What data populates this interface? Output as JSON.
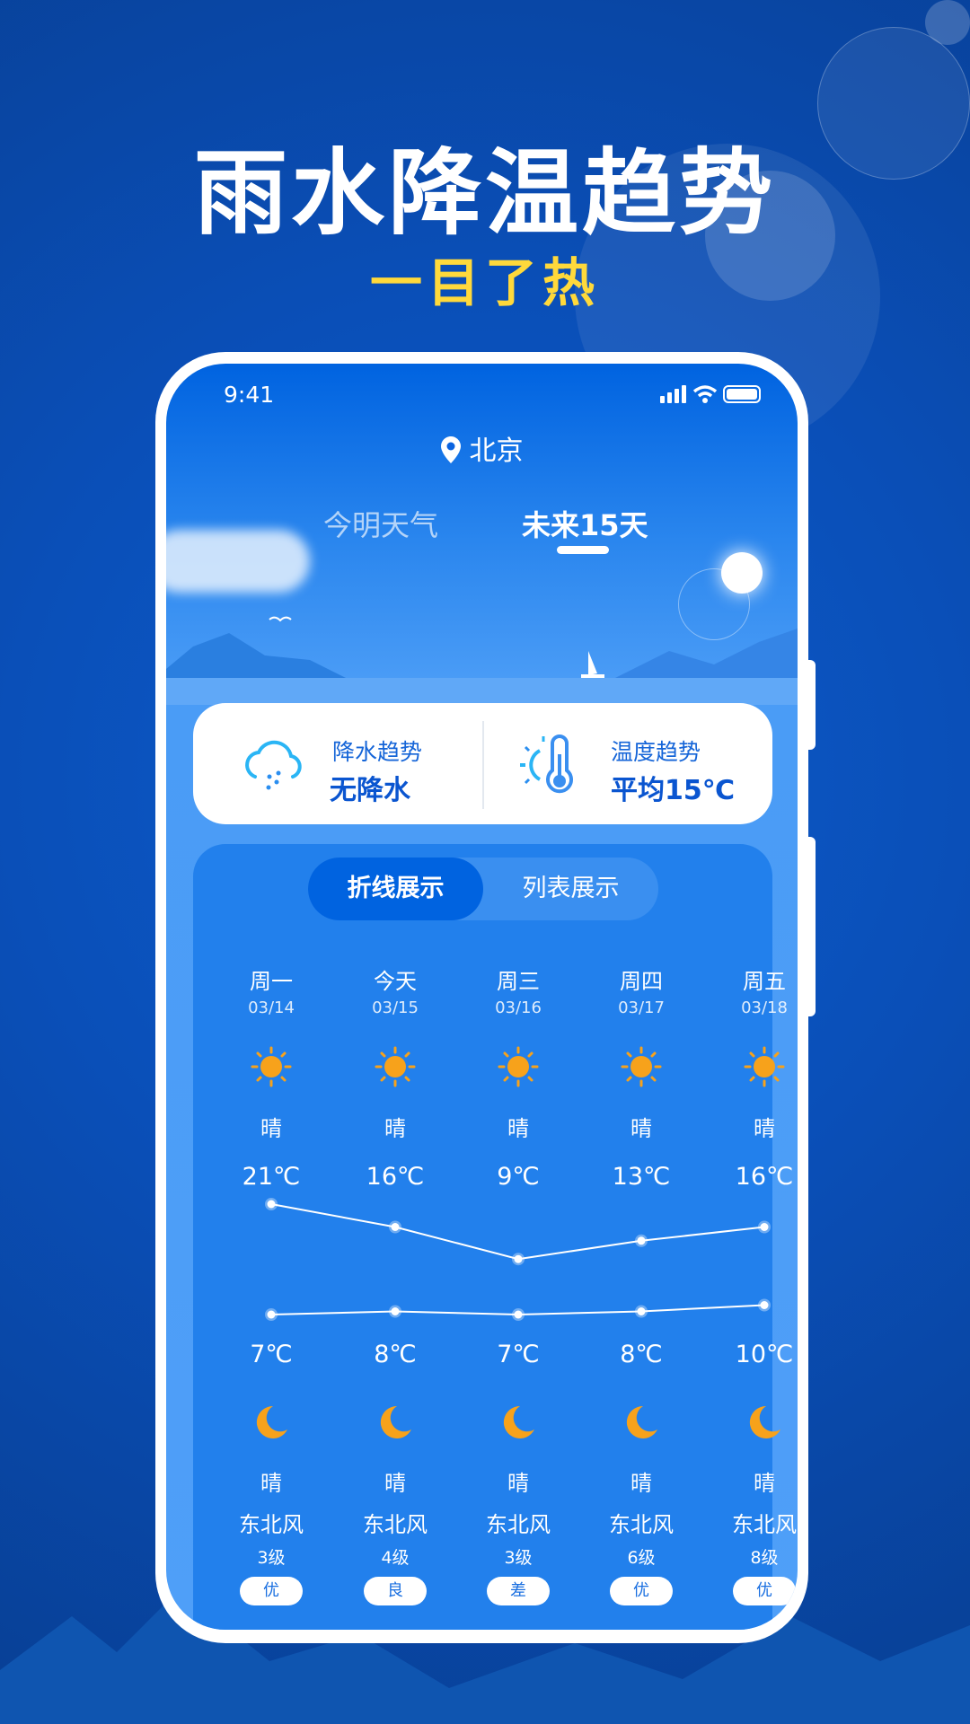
{
  "promo": {
    "title": "雨水降温趋势",
    "subtitle": "一目了热"
  },
  "status_bar": {
    "time": "9:41"
  },
  "location": {
    "city": "北京",
    "icon": "location-pin-icon"
  },
  "tabs": [
    {
      "label": "今明天气",
      "active": false
    },
    {
      "label": "未来15天",
      "active": true
    }
  ],
  "summary": {
    "precipitation": {
      "label": "降水趋势",
      "value": "无降水",
      "icon": "rain-cloud-icon"
    },
    "temperature": {
      "label": "温度趋势",
      "value": "平均15℃",
      "icon": "thermometer-sun-icon"
    }
  },
  "view_toggle": [
    {
      "label": "折线展示",
      "active": true
    },
    {
      "label": "列表展示",
      "active": false
    }
  ],
  "days": [
    {
      "day": "周一",
      "date": "03/14",
      "day_weather": "晴",
      "high": "21℃",
      "low": "7℃",
      "night_weather": "晴",
      "wind": "东北风",
      "level": "3级",
      "aqi": "优"
    },
    {
      "day": "今天",
      "date": "03/15",
      "day_weather": "晴",
      "high": "16℃",
      "low": "8℃",
      "night_weather": "晴",
      "wind": "东北风",
      "level": "4级",
      "aqi": "良"
    },
    {
      "day": "周三",
      "date": "03/16",
      "day_weather": "晴",
      "high": "9℃",
      "low": "7℃",
      "night_weather": "晴",
      "wind": "东北风",
      "level": "3级",
      "aqi": "差"
    },
    {
      "day": "周四",
      "date": "03/17",
      "day_weather": "晴",
      "high": "13℃",
      "low": "8℃",
      "night_weather": "晴",
      "wind": "东北风",
      "level": "6级",
      "aqi": "优"
    },
    {
      "day": "周五",
      "date": "03/18",
      "day_weather": "晴",
      "high": "16℃",
      "low": "10℃",
      "night_weather": "晴",
      "wind": "东北风",
      "level": "8级",
      "aqi": "优"
    }
  ],
  "colors": {
    "accent": "#0a55d0",
    "sun": "#f7a21b",
    "aqi_text": "#1a6fe0",
    "promo_subtitle": "#ffd93b"
  }
}
